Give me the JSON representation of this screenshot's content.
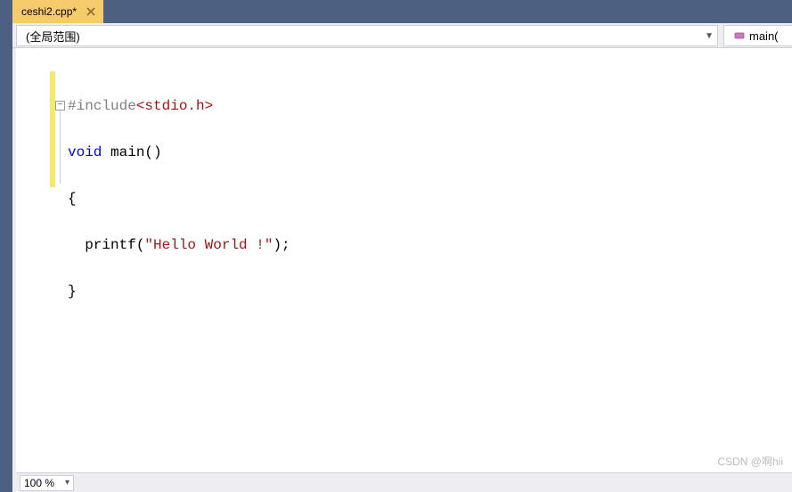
{
  "tab": {
    "filename": "ceshi2.cpp*",
    "close_tooltip": "Close"
  },
  "dropdowns": {
    "scope": "(全局范围)",
    "member": "main("
  },
  "code": {
    "line1_preproc": "#include",
    "line1_path": "<stdio.h>",
    "line2_kw1": "void",
    "line2_func": " main",
    "line2_parens": "()",
    "line3_brace": "{",
    "line4_indent": "  printf(",
    "line4_str": "\"Hello World !\"",
    "line4_end": ");",
    "line5_brace": "}"
  },
  "status": {
    "zoom": "100 %"
  },
  "watermark": "CSDN @啊hii"
}
